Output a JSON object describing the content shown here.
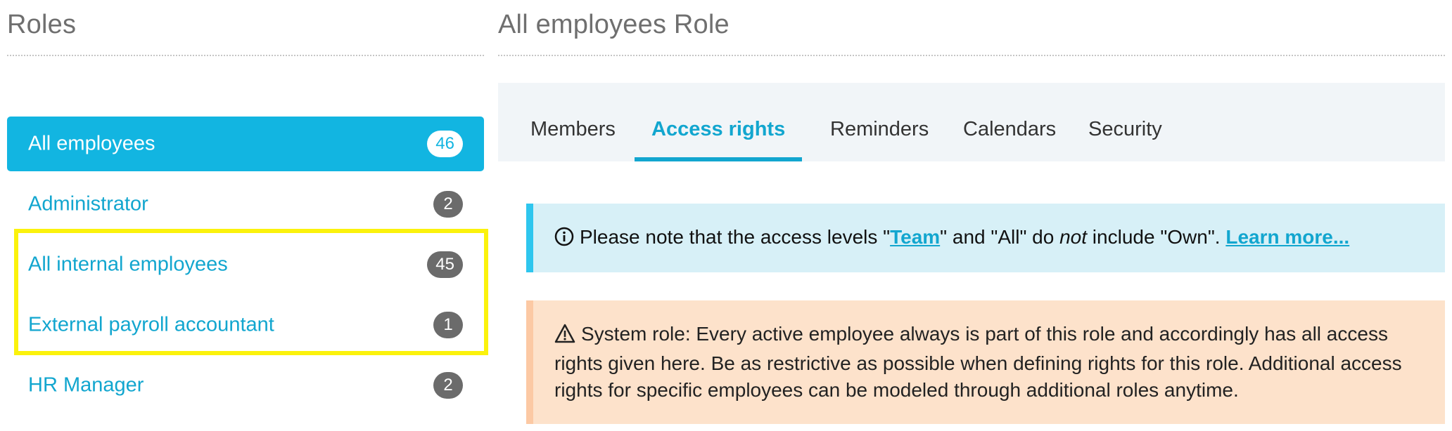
{
  "left": {
    "title": "Roles",
    "roles": [
      {
        "label": "All employees",
        "count": "46",
        "active": true
      },
      {
        "label": "Administrator",
        "count": "2"
      },
      {
        "label": "All internal employees",
        "count": "45"
      },
      {
        "label": "External payroll accountant",
        "count": "1"
      },
      {
        "label": "HR Manager",
        "count": "2"
      }
    ]
  },
  "right": {
    "title": "All employees Role",
    "tabs": [
      {
        "label": "Members"
      },
      {
        "label": "Access rights",
        "active": true
      },
      {
        "label": "Reminders"
      },
      {
        "label": "Calendars"
      },
      {
        "label": "Security"
      }
    ],
    "info": {
      "icon": "info-circle-icon",
      "text_1": "Please note that the access levels \"",
      "link_team": "Team",
      "text_2": "\" and \"All\" do ",
      "emphasis": "not",
      "text_3": " include \"Own\". ",
      "link_more": "Learn more..."
    },
    "warning": {
      "icon": "warning-triangle-icon",
      "text": "System role: Every active employee always is part of this role and accordingly has all access rights given here. Be as restrictive as possible when defining rights for this role. Additional access rights for specific employees can be modeled through additional roles anytime."
    }
  },
  "colors": {
    "accent": "#12b5e1",
    "link": "#12a6cf",
    "highlight": "#fbf20c",
    "badge": "#6b6b6b",
    "info_bg": "#d7f0f7",
    "warning_bg": "#fde2cb"
  }
}
